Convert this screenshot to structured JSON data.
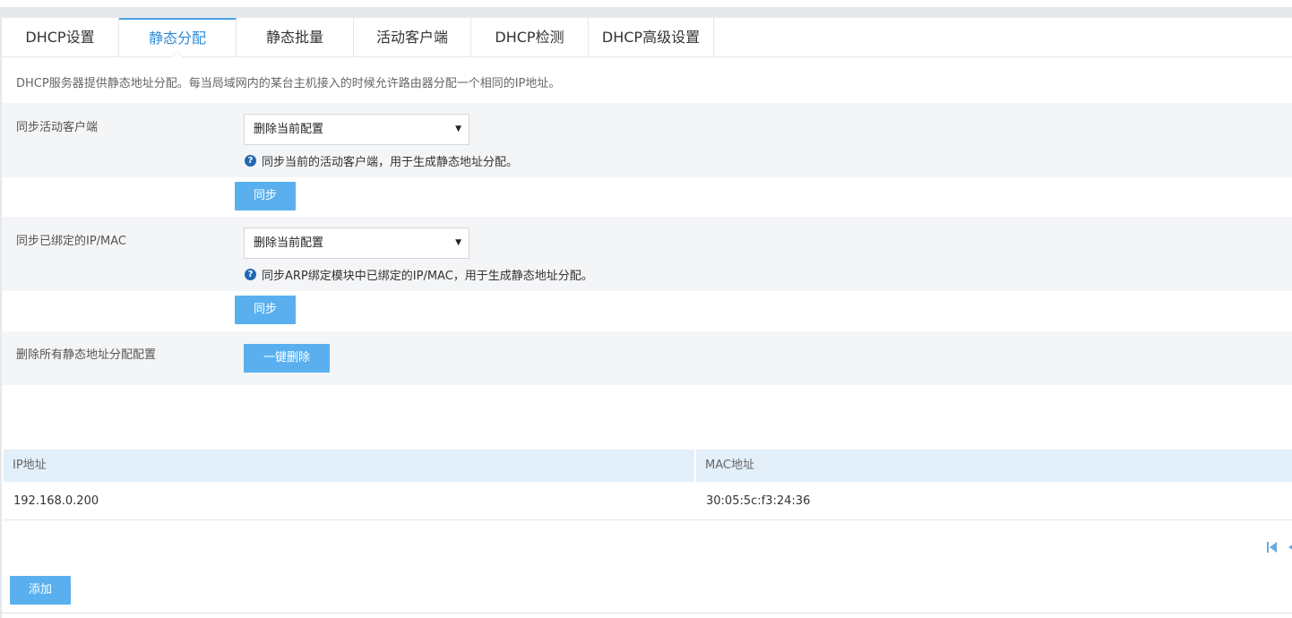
{
  "tabs": [
    {
      "label": "DHCP设置",
      "active": false
    },
    {
      "label": "静态分配",
      "active": true
    },
    {
      "label": "静态批量",
      "active": false
    },
    {
      "label": "活动客户端",
      "active": false
    },
    {
      "label": "DHCP检测",
      "active": false
    },
    {
      "label": "DHCP高级设置",
      "active": false
    }
  ],
  "description": "DHCP服务器提供静态地址分配。每当局域网内的某台主机接入的时候允许路由器分配一个相同的IP地址。",
  "sync_clients": {
    "label": "同步活动客户端",
    "select_value": "删除当前配置",
    "hint": "同步当前的活动客户端，用于生成静态地址分配。",
    "button": "同步"
  },
  "sync_bound": {
    "label": "同步已绑定的IP/MAC",
    "select_value": "删除当前配置",
    "hint": "同步ARP绑定模块中已绑定的IP/MAC，用于生成静态地址分配。",
    "button": "同步"
  },
  "delete_all": {
    "label": "删除所有静态地址分配配置",
    "button": "一键删除"
  },
  "table": {
    "columns": [
      "IP地址",
      "MAC地址"
    ],
    "rows": [
      {
        "ip": "192.168.0.200",
        "mac": "30:05:5c:f3:24:36"
      }
    ]
  },
  "add_button": "添加",
  "colors": {
    "accent": "#2d8ad8",
    "button": "#5ab0ee",
    "table_header": "#e3eff9",
    "row_gray": "#f4f5f7",
    "help_icon": "#2067b6"
  },
  "icons": {
    "help": "question-circle-icon",
    "select": "triangle-down-icon",
    "first_page": "first-page-icon",
    "prev_page": "prev-page-icon"
  }
}
